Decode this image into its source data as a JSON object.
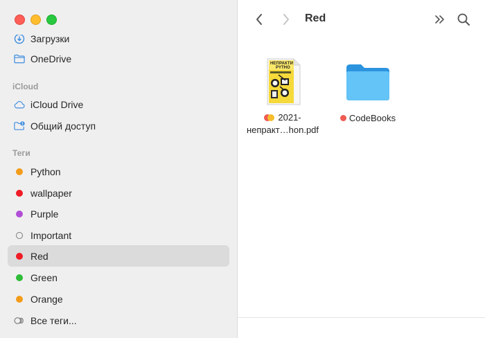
{
  "sidebar": {
    "partial_top_label": "Загрузки",
    "onedrive": "OneDrive",
    "section_icloud": "iCloud",
    "icloud_drive": "iCloud Drive",
    "shared": "Общий доступ",
    "section_tags": "Теги",
    "tags": [
      {
        "label": "Python",
        "color": "#f39c1a"
      },
      {
        "label": "wallpaper",
        "color": "#ef1c25"
      },
      {
        "label": "Purple",
        "color": "#b04fd6"
      },
      {
        "label": "Important",
        "color": "none"
      },
      {
        "label": "Red",
        "color": "#ef1c25"
      },
      {
        "label": "Green",
        "color": "#2ebd38"
      },
      {
        "label": "Orange",
        "color": "#f39c1a"
      }
    ],
    "all_tags": "Все теги...",
    "selected": "Red"
  },
  "toolbar": {
    "title": "Red"
  },
  "files": [
    {
      "name_line1": "2021-",
      "name_line2": "непракт…hon.pdf",
      "tag_colors": [
        "#ef5b52",
        "#f6be2c"
      ],
      "kind": "pdf",
      "thumb_text_1": "НЕПРАКТИ",
      "thumb_text_2": "PYTHO"
    },
    {
      "name_line1": "CodeBooks",
      "tag_colors": [
        "#ef5b52"
      ],
      "kind": "folder"
    }
  ],
  "colors": {
    "accent_blue": "#3b8de0",
    "folder_blue": "#5bb8f0"
  }
}
